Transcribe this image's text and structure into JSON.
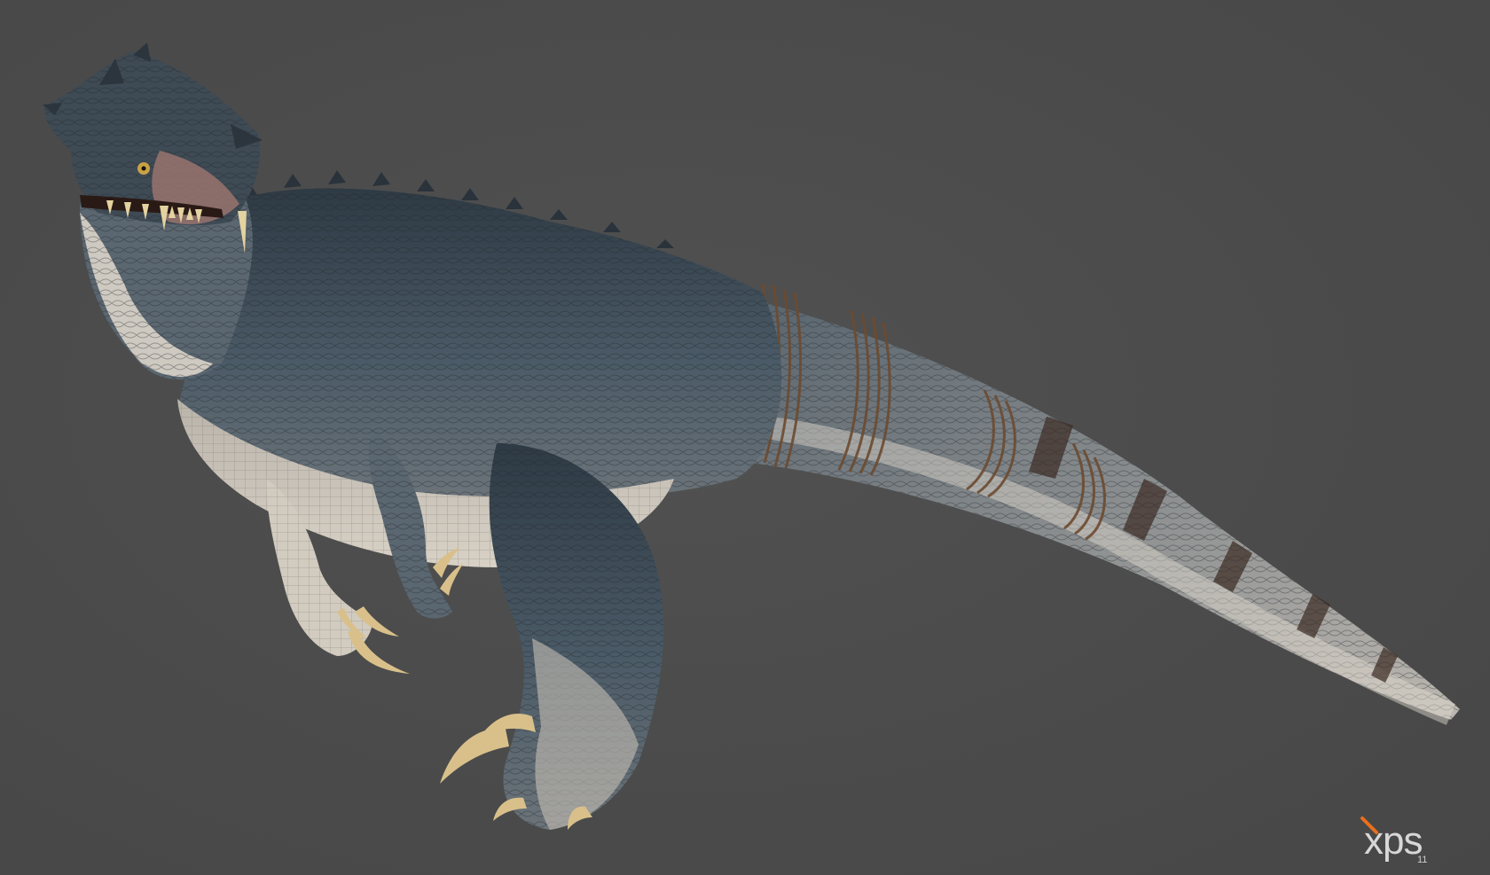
{
  "viewport": {
    "background_color": "#4b4b4b"
  },
  "model": {
    "body_color": "#3a4650",
    "belly_color": "#c9c2b8",
    "stripe_color": "#3a2a22",
    "rope_color": "#6b4a30",
    "claw_color": "#d9c08a",
    "teeth_color": "#e3d3a0"
  },
  "watermark": {
    "logo_text": "xps",
    "version": "11",
    "accent_color": "#e8701c"
  }
}
